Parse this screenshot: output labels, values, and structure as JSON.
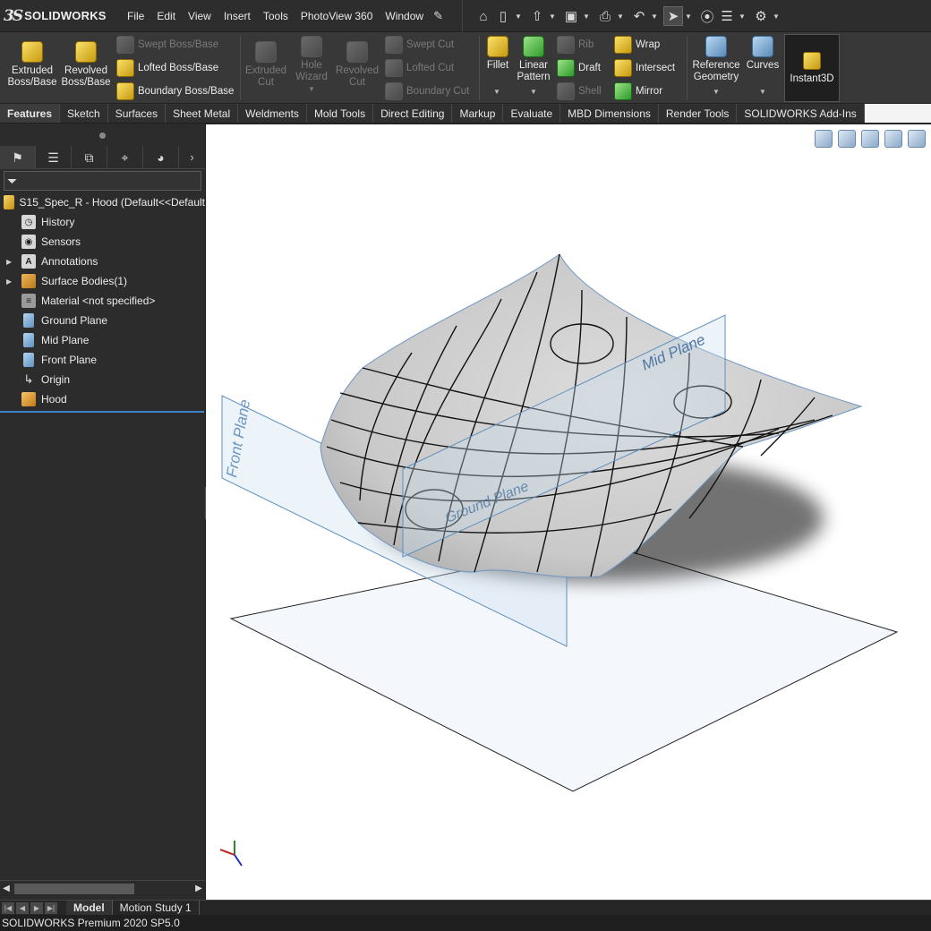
{
  "app": {
    "logo_mark": "3S",
    "logo_text": "SOLIDWORKS",
    "status": "SOLIDWORKS Premium 2020 SP5.0"
  },
  "menu": [
    "File",
    "Edit",
    "View",
    "Insert",
    "Tools",
    "PhotoView 360",
    "Window"
  ],
  "features": {
    "extruded_boss": [
      "Extruded",
      "Boss/Base"
    ],
    "revolved_boss": [
      "Revolved",
      "Boss/Base"
    ],
    "swept_boss": "Swept Boss/Base",
    "lofted_boss": "Lofted Boss/Base",
    "boundary_boss": "Boundary Boss/Base",
    "extruded_cut": [
      "Extruded",
      "Cut"
    ],
    "hole_wizard": [
      "Hole",
      "Wizard"
    ],
    "revolved_cut": [
      "Revolved",
      "Cut"
    ],
    "swept_cut": "Swept Cut",
    "lofted_cut": "Lofted Cut",
    "boundary_cut": "Boundary Cut",
    "fillet": "Fillet",
    "linear_pattern": [
      "Linear",
      "Pattern"
    ],
    "rib": "Rib",
    "draft": "Draft",
    "shell": "Shell",
    "wrap": "Wrap",
    "intersect": "Intersect",
    "mirror": "Mirror",
    "reference_geometry": [
      "Reference",
      "Geometry"
    ],
    "curves": "Curves",
    "instant3d": "Instant3D"
  },
  "tabs": [
    "Features",
    "Sketch",
    "Surfaces",
    "Sheet Metal",
    "Weldments",
    "Mold Tools",
    "Direct Editing",
    "Markup",
    "Evaluate",
    "MBD Dimensions",
    "Render Tools",
    "SOLIDWORKS Add-Ins"
  ],
  "tree": {
    "root": "S15_Spec_R - Hood  (Default<<Default",
    "history": "History",
    "sensors": "Sensors",
    "annotations": "Annotations",
    "surface_bodies": "Surface Bodies(1)",
    "material": "Material <not specified>",
    "ground_plane": "Ground Plane",
    "mid_plane": "Mid Plane",
    "front_plane": "Front Plane",
    "origin": "Origin",
    "hood": "Hood"
  },
  "viewport": {
    "front_plane_label": "Front Plane",
    "mid_plane_label": "Mid Plane",
    "ground_plane_label": "Ground Plane"
  },
  "bottom_tabs": [
    "Model",
    "Motion Study 1"
  ]
}
